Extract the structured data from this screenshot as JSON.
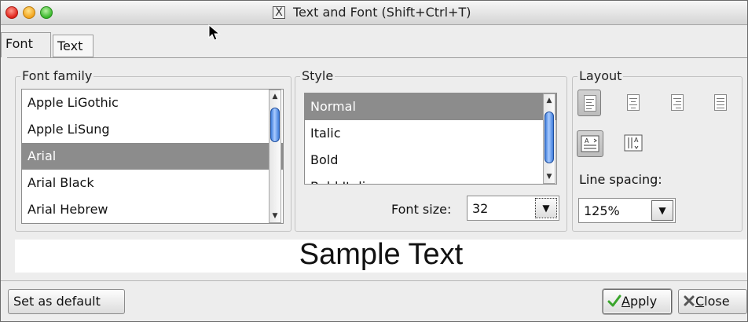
{
  "window": {
    "title": "Text and Font (Shift+Ctrl+T)",
    "app_icon": "x11-icon",
    "app_icon_glyph": "X",
    "controls": [
      "close",
      "minimize",
      "maximize"
    ]
  },
  "tabs": [
    {
      "label": "Font",
      "selected": true
    },
    {
      "label": "Text",
      "selected": false
    }
  ],
  "font_family": {
    "group_label": "Font family",
    "items": [
      "Apple LiGothic",
      "Apple LiSung",
      "Arial",
      "Arial Black",
      "Arial Hebrew"
    ],
    "selected": "Arial"
  },
  "style": {
    "group_label": "Style",
    "items": [
      "Normal",
      "Italic",
      "Bold",
      "Bold Italic"
    ],
    "selected": "Normal",
    "font_size_label": "Font size:",
    "font_size_value": "32"
  },
  "layout": {
    "group_label": "Layout",
    "alignments": [
      "left",
      "center",
      "right",
      "justify"
    ],
    "active_alignment": "left",
    "directions": [
      "horizontal",
      "vertical"
    ],
    "active_direction": "horizontal",
    "line_spacing_label": "Line spacing:",
    "line_spacing_value": "125%"
  },
  "sample": {
    "text": "Sample Text"
  },
  "buttons": {
    "set_default": "Set as default",
    "apply_rest": "pply",
    "apply_mnemonic": "A",
    "close_rest": "lose",
    "close_mnemonic": "C"
  },
  "colors": {
    "selection": "#8c8c8c",
    "scroll_thumb": "#3f7ddb",
    "apply_check": "#3aa52c",
    "close_x": "#555555"
  }
}
